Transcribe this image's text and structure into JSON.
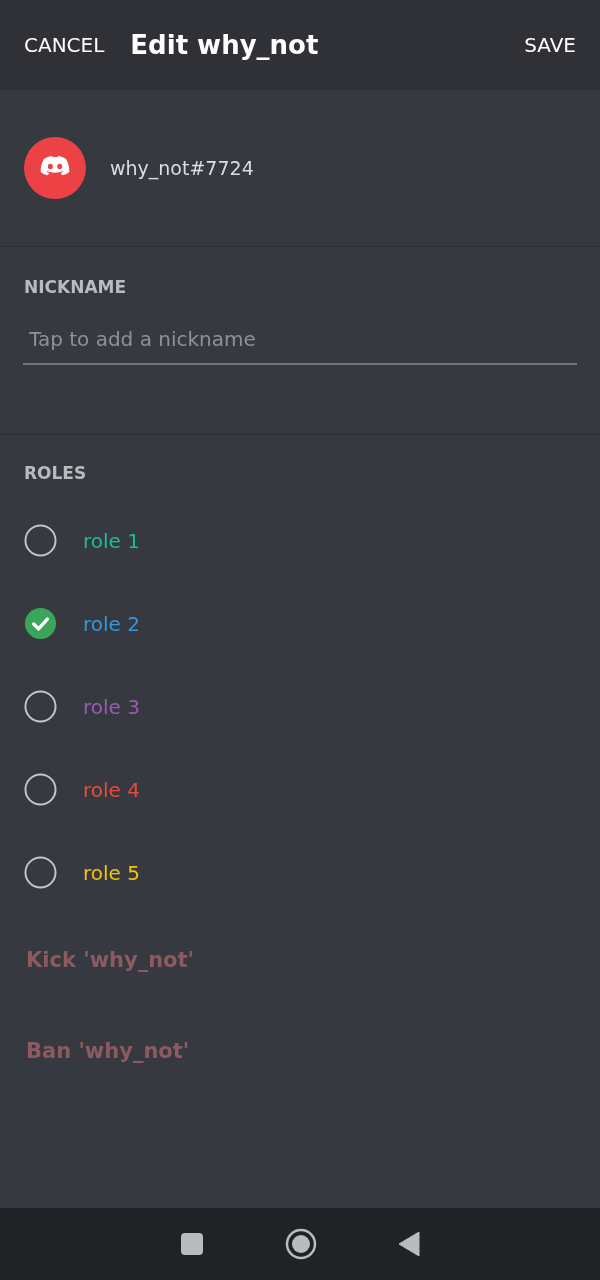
{
  "header": {
    "cancel": "CANCEL",
    "title": "Edit why_not",
    "save": "SAVE"
  },
  "user": {
    "tag": "why_not#7724"
  },
  "nickname": {
    "label": "NICKNAME",
    "placeholder": "Tap to add a nickname"
  },
  "roles": {
    "label": "ROLES",
    "items": [
      {
        "name": "role 1",
        "color": "#1abc9c",
        "checked": false
      },
      {
        "name": "role 2",
        "color": "#3498db",
        "checked": true
      },
      {
        "name": "role 3",
        "color": "#9b59b6",
        "checked": false
      },
      {
        "name": "role 4",
        "color": "#e74c3c",
        "checked": false
      },
      {
        "name": "role 5",
        "color": "#f1c40f",
        "checked": false
      }
    ]
  },
  "actions": [
    {
      "label": "Kick 'why_not'",
      "disabled": true
    },
    {
      "label": "Ban 'why_not'",
      "disabled": true
    }
  ]
}
